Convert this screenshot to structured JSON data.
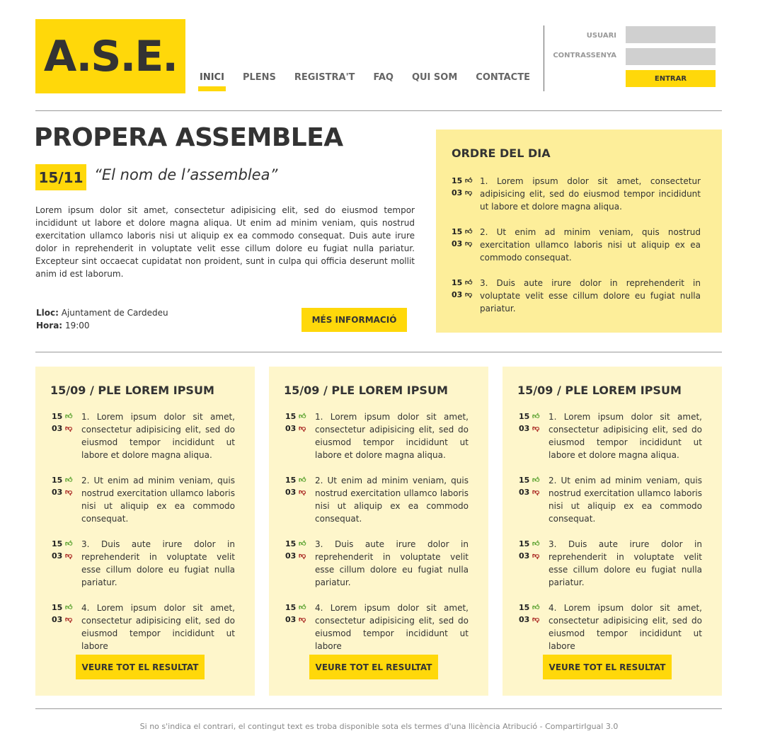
{
  "logo": {
    "text": "A.S.E."
  },
  "nav": [
    {
      "label": "INICI",
      "active": true
    },
    {
      "label": "PLENS",
      "active": false
    },
    {
      "label": "REGISTRA'T",
      "active": false
    },
    {
      "label": "FAQ",
      "active": false
    },
    {
      "label": "QUI SOM",
      "active": false
    },
    {
      "label": "CONTACTE",
      "active": false
    }
  ],
  "login": {
    "user_label": "USUARI",
    "password_label": "CONTRASSENYA",
    "user_value": "",
    "password_value": "",
    "submit_label": "ENTRAR"
  },
  "next_assembly": {
    "title": "PROPERA ASSEMBLEA",
    "date": "15/11",
    "name": "“El nom de l’assemblea”",
    "intro": "Lorem ipsum dolor sit amet, consectetur adipisicing elit, sed do eiusmod tempor incididunt ut labore et dolore magna aliqua. Ut enim ad minim veniam, quis nostrud exercitation ullamco laboris nisi ut aliquip ex ea commodo consequat. Duis aute irure dolor in reprehenderit in voluptate velit esse cillum dolore eu fugiat nulla pariatur. Excepteur sint occaecat cupidatat non proident, sunt in culpa qui officia deserunt mollit anim id est laborum.",
    "place_label": "Lloc:",
    "place_value": "Ajuntament de Cardedeu",
    "time_label": "Hora:",
    "time_value": "19:00",
    "more_label": "MÉS INFORMACIÓ"
  },
  "agenda": {
    "title": "ORDRE DEL DIA",
    "items": [
      {
        "up": "15",
        "down": "03",
        "text": "1. Lorem ipsum dolor sit amet, consectetur adipisicing elit, sed do eiusmod tempor incididunt ut labore et dolore magna aliqua."
      },
      {
        "up": "15",
        "down": "03",
        "text": "2. Ut enim ad minim veniam, quis nostrud exercitation ullamco laboris nisi ut aliquip ex ea commodo consequat."
      },
      {
        "up": "15",
        "down": "03",
        "text": "3. Duis aute irure dolor in reprehenderit in voluptate velit esse cillum dolore eu fugiat nulla pariatur."
      }
    ]
  },
  "plenaries": [
    {
      "title": "15/09 / PLE LOREM IPSUM",
      "button": "VEURE TOT EL RESULTAT",
      "items": [
        {
          "up": "15",
          "down": "03",
          "text": "1. Lorem ipsum dolor sit amet, consectetur adipisicing elit, sed do eiusmod tempor incididunt ut labore et dolore magna aliqua."
        },
        {
          "up": "15",
          "down": "03",
          "text": "2. Ut enim ad minim veniam, quis nostrud exercitation ullamco laboris nisi ut aliquip ex ea commodo consequat."
        },
        {
          "up": "15",
          "down": "03",
          "text": "3. Duis aute irure dolor in reprehenderit in voluptate velit esse cillum dolore eu fugiat nulla pariatur."
        },
        {
          "up": "15",
          "down": "03",
          "text": "4. Lorem ipsum dolor sit amet, consectetur adipisicing elit, sed do eiusmod tempor incididunt ut labore"
        }
      ]
    },
    {
      "title": "15/09 / PLE LOREM IPSUM",
      "button": "VEURE TOT EL RESULTAT",
      "items": [
        {
          "up": "15",
          "down": "03",
          "text": "1. Lorem ipsum dolor sit amet, consectetur adipisicing elit, sed do eiusmod tempor incididunt ut labore et dolore magna aliqua."
        },
        {
          "up": "15",
          "down": "03",
          "text": "2. Ut enim ad minim veniam, quis nostrud exercitation ullamco laboris nisi ut aliquip ex ea commodo consequat."
        },
        {
          "up": "15",
          "down": "03",
          "text": "3. Duis aute irure dolor in reprehenderit in voluptate velit esse cillum dolore eu fugiat nulla pariatur."
        },
        {
          "up": "15",
          "down": "03",
          "text": "4. Lorem ipsum dolor sit amet, consectetur adipisicing elit, sed do eiusmod tempor incididunt ut labore"
        }
      ]
    },
    {
      "title": "15/09 / PLE LOREM IPSUM",
      "button": "VEURE TOT EL RESULTAT",
      "items": [
        {
          "up": "15",
          "down": "03",
          "text": "1. Lorem ipsum dolor sit amet, consectetur adipisicing elit, sed do eiusmod tempor incididunt ut labore et dolore magna aliqua."
        },
        {
          "up": "15",
          "down": "03",
          "text": "2. Ut enim ad minim veniam, quis nostrud exercitation ullamco laboris nisi ut aliquip ex ea commodo consequat."
        },
        {
          "up": "15",
          "down": "03",
          "text": "3. Duis aute irure dolor in reprehenderit in voluptate velit esse cillum dolore eu fugiat nulla pariatur."
        },
        {
          "up": "15",
          "down": "03",
          "text": "4. Lorem ipsum dolor sit amet, consectetur adipisicing elit, sed do eiusmod tempor incididunt ut labore"
        }
      ]
    }
  ],
  "footer": {
    "text": "Si no s'indica el contrari, el contingut text es troba disponible sota els termes d'una llicència Atribució - CompartirIgual 3.0"
  },
  "colors": {
    "accent": "#ffd80a",
    "agenda_bg": "#fdee9a",
    "card_bg": "#fef6cb",
    "thumb_up": "#4a9a20",
    "thumb_down": "#a01010"
  }
}
